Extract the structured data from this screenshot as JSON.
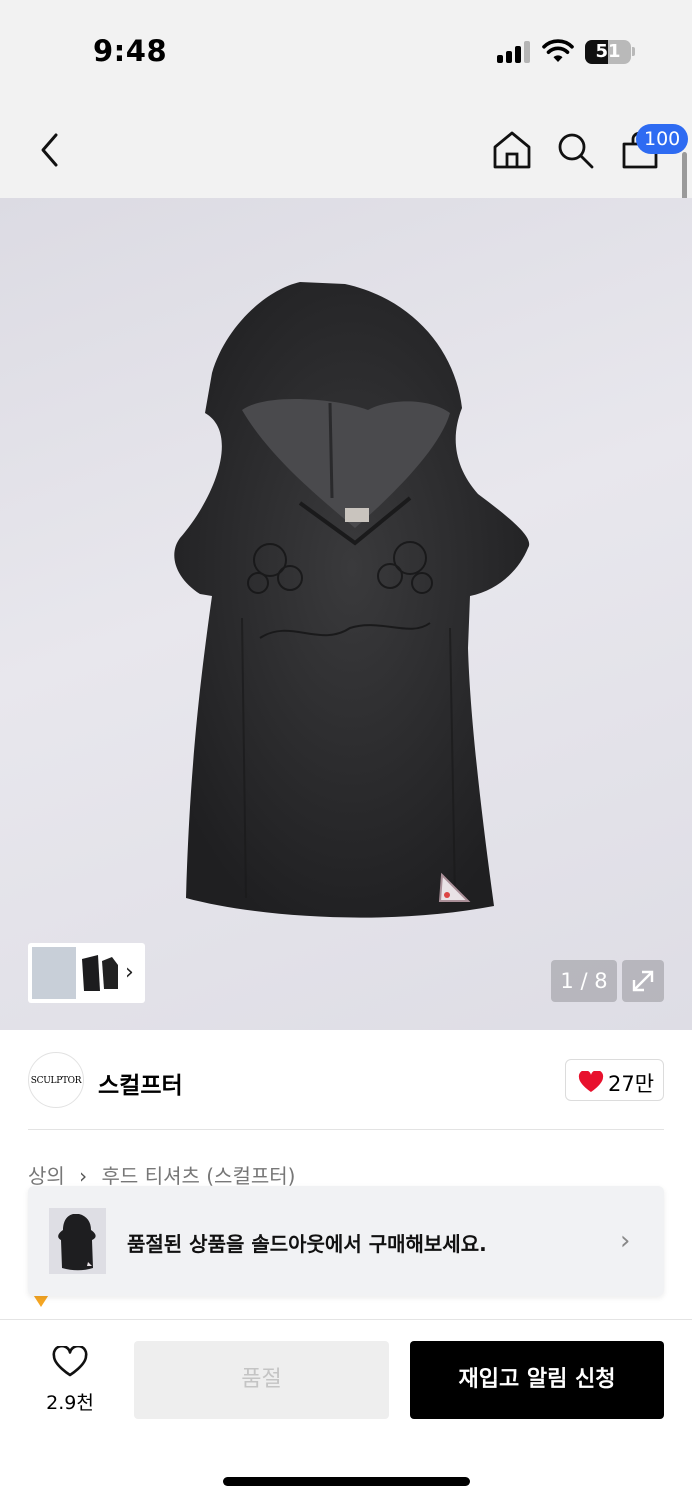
{
  "status_bar": {
    "time": "9:48",
    "battery": "51",
    "battery_level": 0.51
  },
  "header": {
    "icons": [
      "back-chevron-icon",
      "home-icon",
      "search-icon",
      "cart-icon"
    ],
    "cart_count": "100"
  },
  "gallery": {
    "page_indicator": "1 / 8",
    "current_page": 1,
    "total_pages": 8
  },
  "brand": {
    "logo_text": "SCULPTOR",
    "name": "스컬프터",
    "likes": "27만"
  },
  "breadcrumb": {
    "category": "상의",
    "subcategory": "후드 티셔츠 (스컬프터)"
  },
  "soldout_banner": {
    "text": "품절된 상품을 솔드아웃에서 구매해보세요."
  },
  "bottom_bar": {
    "wish_count": "2.9천",
    "soldout_label": "품절",
    "restock_label": "재입고 알림 신청"
  },
  "colors": {
    "accent_blue": "#2e6bf2",
    "heart_red": "#e8112d",
    "primary_button": "#000000"
  }
}
